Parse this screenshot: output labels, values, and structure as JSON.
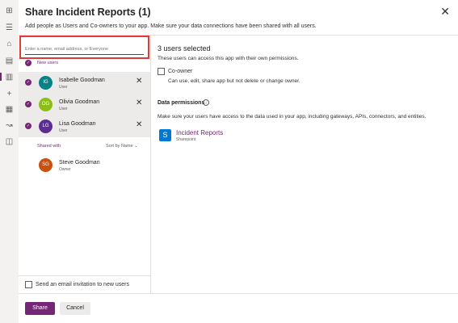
{
  "dialog": {
    "title": "Share Incident Reports (1)",
    "subtitle": "Add people as Users and Co-owners to your app. Make sure your data connections have been shared with all users.",
    "close_icon": "close-icon"
  },
  "search": {
    "placeholder": "Enter a name, email address, or Everyone"
  },
  "new_users": {
    "label": "New users",
    "users": [
      {
        "initials": "IG",
        "name": "Isabelle Goodman",
        "role": "User",
        "color": "#038387"
      },
      {
        "initials": "OG",
        "name": "Olivia Goodman",
        "role": "User",
        "color": "#8cbd18"
      },
      {
        "initials": "LG",
        "name": "Lisa Goodman",
        "role": "User",
        "color": "#5c2e91"
      }
    ]
  },
  "shared_with": {
    "label": "Shared with",
    "sort_label": "Sort by Name",
    "owner": {
      "initials": "SG",
      "name": "Steve Goodman",
      "role": "Owner",
      "color": "#ca5010"
    }
  },
  "email_invite": {
    "label": "Send an email invitation to new users",
    "checked": false
  },
  "right": {
    "selected_heading": "3 users selected",
    "access_text": "These users can access this app with their own permissions.",
    "coowner_label": "Co-owner",
    "coowner_desc": "Can use, edit, share app but not delete or change owner.",
    "data_permissions_title": "Data permissions",
    "data_permissions_text": "Make sure your users have access to the data used in your app, including gateways, APIs, connectors, and entities.",
    "datasource": {
      "name": "Incident Reports",
      "type": "Sharepoint"
    }
  },
  "buttons": {
    "share": "Share",
    "cancel": "Cancel"
  },
  "colors": {
    "accent": "#742774",
    "highlight": "#e03b3b"
  }
}
